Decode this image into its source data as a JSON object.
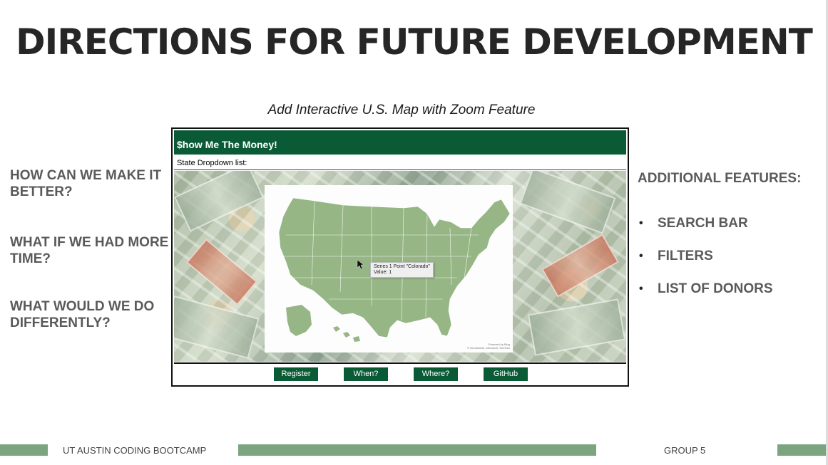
{
  "slide": {
    "title": "DIRECTIONS FOR FUTURE DEVELOPMENT",
    "subtitle": "Add Interactive U.S. Map with Zoom Feature"
  },
  "left_questions": [
    "HOW CAN WE MAKE IT BETTER?",
    "WHAT IF WE HAD MORE TIME?",
    "WHAT WOULD WE DO DIFFERENTLY?"
  ],
  "right": {
    "heading": "ADDITIONAL FEATURES:",
    "bullets": [
      "SEARCH BAR",
      "FILTERS",
      "LIST OF DONORS"
    ]
  },
  "app": {
    "header_title": "$how Me The Money!",
    "dropdown_label": "State Dropdown list:",
    "tooltip_line1": "Series 1 Point \"Colorado\"",
    "tooltip_line2": "Value: 1",
    "credit_line1": "Powered by Bing",
    "credit_line2": "© GeoNames, Microsoft, TomTom",
    "buttons": [
      "Register",
      "When?",
      "Where?",
      "GitHub"
    ]
  },
  "footer": {
    "left_text": "UT AUSTIN CODING BOOTCAMP",
    "right_text": "GROUP 5"
  },
  "colors": {
    "brand_green": "#0b5a36",
    "bar_green": "#7aa57f",
    "map_green": "#96b686"
  }
}
